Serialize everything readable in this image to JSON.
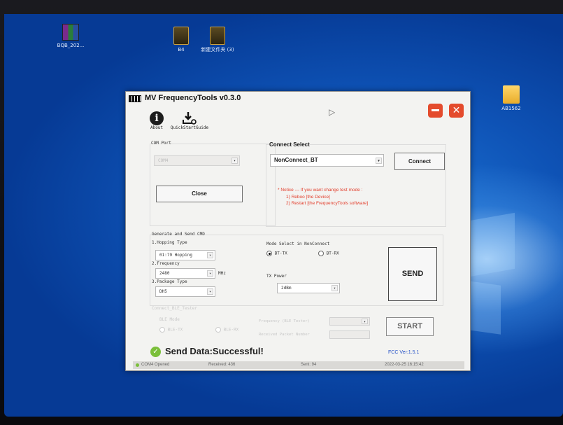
{
  "desktop": {
    "icons": [
      {
        "id": "rar",
        "label": "BQB_202..."
      },
      {
        "id": "b4",
        "label": "B4"
      },
      {
        "id": "newfolder",
        "label": "新建文件夹 (3)"
      },
      {
        "id": "ab1562",
        "label": "AB1562"
      }
    ]
  },
  "app": {
    "title": "MV FrequencyTools v0.3.0",
    "toolbar": {
      "about": "About",
      "quickstart": "QuickStartGuide"
    },
    "com_port": {
      "label": "COM Port",
      "value": "COM4",
      "button": "Close"
    },
    "connect": {
      "label": "Connect Select",
      "value": "NonConnect_BT",
      "button": "Connect",
      "notice_line1": "* Notice --- If you want change test mode :",
      "notice_line2": "1) Reboo [the Device]",
      "notice_line3": "2) Restart [the FrequencyTools software]"
    },
    "generate": {
      "title": "Generate and Send CMD",
      "hopping_label": "1.Hopping Type",
      "hopping_value": "01:79 Hopping",
      "frequency_label": "2.Frequency",
      "frequency_value": "2480",
      "frequency_unit": "MHz",
      "package_label": "3.Package Type",
      "package_value": "DH5"
    },
    "mode": {
      "label": "Mode Select in NonConnect",
      "option1": "BT-TX",
      "option2": "BT-RX",
      "tx_power_label": "TX Power",
      "tx_power_value": "2dBm"
    },
    "send_button": "SEND",
    "ble": {
      "title": "Connect_BLE_Tester",
      "mode_label": "BLE Mode",
      "option1": "BLE-TX",
      "option2": "BLE-RX",
      "freq_label": "Frequency (BLE Tester)",
      "packet_label": "Received Packet Number",
      "start_button": "START"
    },
    "result": {
      "text": "Send Data:Successful!"
    },
    "version": "FCC Ver:1.5.1",
    "statusbar": {
      "com": "COM4 Opened",
      "received": "Received: 436",
      "sent": "Sent: 94",
      "datetime": "2022-03-25 16:15:42"
    }
  },
  "colors": {
    "notice_red": "#e23c2a",
    "version_blue": "#2a55c8",
    "close_red": "#e44b2d",
    "success_green": "#7bbf3a",
    "desktop_blue": "#0e52b5"
  }
}
